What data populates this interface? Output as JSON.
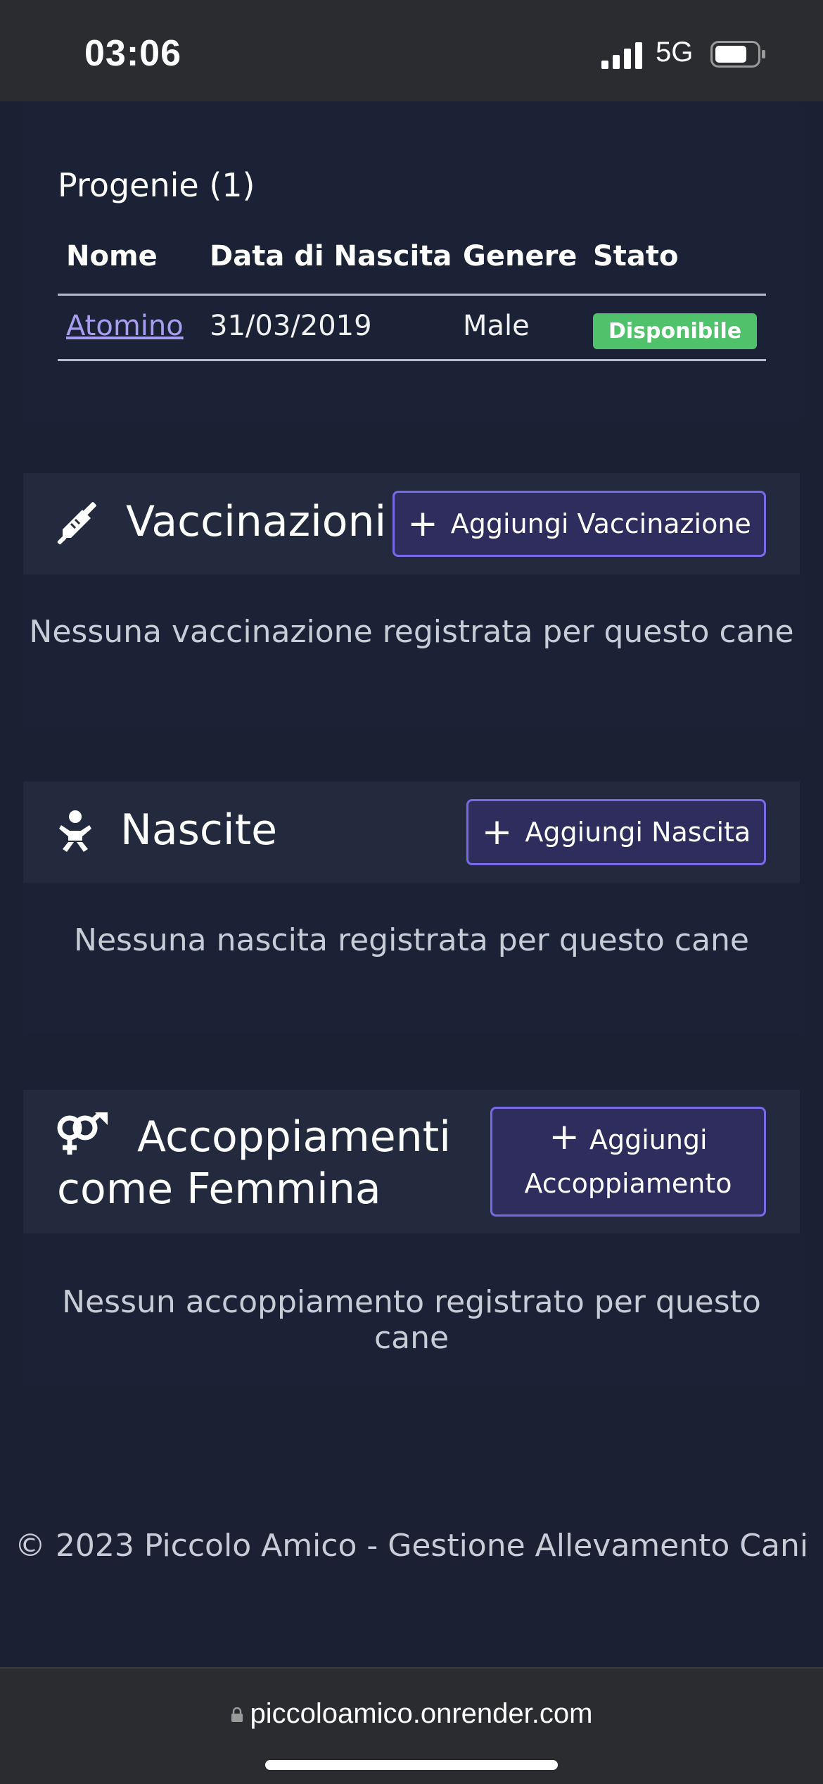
{
  "status_bar": {
    "time": "03:06",
    "network": "5G",
    "icons": [
      "signal-icon",
      "battery-icon"
    ]
  },
  "progeny": {
    "title": "Progenie (1)",
    "columns": [
      "Nome",
      "Data di Nascita",
      "Genere",
      "Stato"
    ],
    "rows": [
      {
        "name": "Atomino",
        "birth_date": "31/03/2019",
        "gender": "Male",
        "status": "Disponibile"
      }
    ],
    "status_color": "#4fc26b"
  },
  "vaccinations": {
    "icon": "syringe-icon",
    "title": "Vaccinazioni",
    "add_label": "Aggiungi Vaccinazione",
    "empty": "Nessuna vaccinazione registrata per questo cane"
  },
  "births": {
    "icon": "baby-icon",
    "title": "Nascite",
    "add_label": "Aggiungi Nascita",
    "empty": "Nessuna nascita registrata per questo cane"
  },
  "matings": {
    "icon": "venus-mars-icon",
    "title_line1": "Accoppiamenti",
    "title_line2": "come Femmina",
    "add_label_line1": "Aggiungi",
    "add_label_line2": "Accoppiamento",
    "empty": "Nessun accoppiamento registrato per questo cane"
  },
  "footer": {
    "text": "© 2023 Piccolo Amico - Gestione Allevamento Cani"
  },
  "browser": {
    "url": "piccoloamico.onrender.com"
  },
  "colors": {
    "background": "#1b2133",
    "accent": "#7a69e6",
    "link": "#a89df0"
  }
}
